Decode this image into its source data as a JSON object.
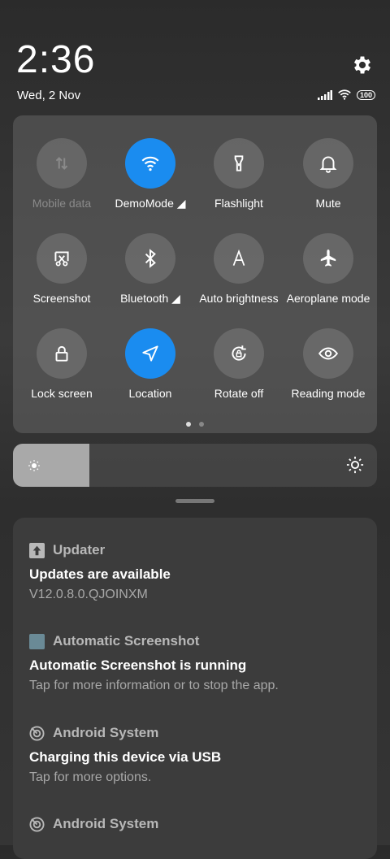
{
  "status": {
    "time": "2:36",
    "date": "Wed, 2 Nov",
    "battery": "100"
  },
  "tiles": [
    {
      "label": "Mobile data",
      "icon": "mobile-data-icon",
      "on": false,
      "dim": true
    },
    {
      "label": "DemoMode ◢",
      "icon": "wifi-icon",
      "on": true,
      "dim": false
    },
    {
      "label": "Flashlight",
      "icon": "flashlight-icon",
      "on": false,
      "dim": false
    },
    {
      "label": "Mute",
      "icon": "bell-icon",
      "on": false,
      "dim": false
    },
    {
      "label": "Screenshot",
      "icon": "screenshot-icon",
      "on": false,
      "dim": false
    },
    {
      "label": "Bluetooth ◢",
      "icon": "bluetooth-icon",
      "on": false,
      "dim": false
    },
    {
      "label": "Auto brightness",
      "icon": "auto-brightness-icon",
      "on": false,
      "dim": false
    },
    {
      "label": "Aeroplane mode",
      "icon": "airplane-icon",
      "on": false,
      "dim": false
    },
    {
      "label": "Lock screen",
      "icon": "lock-icon",
      "on": false,
      "dim": false
    },
    {
      "label": "Location",
      "icon": "location-icon",
      "on": true,
      "dim": false
    },
    {
      "label": "Rotate off",
      "icon": "rotate-lock-icon",
      "on": false,
      "dim": false
    },
    {
      "label": "Reading mode",
      "icon": "eye-icon",
      "on": false,
      "dim": false
    }
  ],
  "pager": {
    "pages": 2,
    "current": 1
  },
  "brightness": {
    "level": 0.21
  },
  "notifications": [
    {
      "app": "Updater",
      "title": "Updates are available",
      "text": "V12.0.8.0.QJOINXM"
    },
    {
      "app": "Automatic Screenshot",
      "title": "Automatic Screenshot is running",
      "text": "Tap for more information or to stop the app."
    },
    {
      "app": "Android System",
      "title": "Charging this device via USB",
      "text": "Tap for more options."
    },
    {
      "app": "Android System",
      "title": "",
      "text": ""
    }
  ],
  "colors": {
    "accent": "#1a8cf0",
    "tile_bg": "#5a5a5a",
    "panel_bg": "#3c3c3c"
  }
}
